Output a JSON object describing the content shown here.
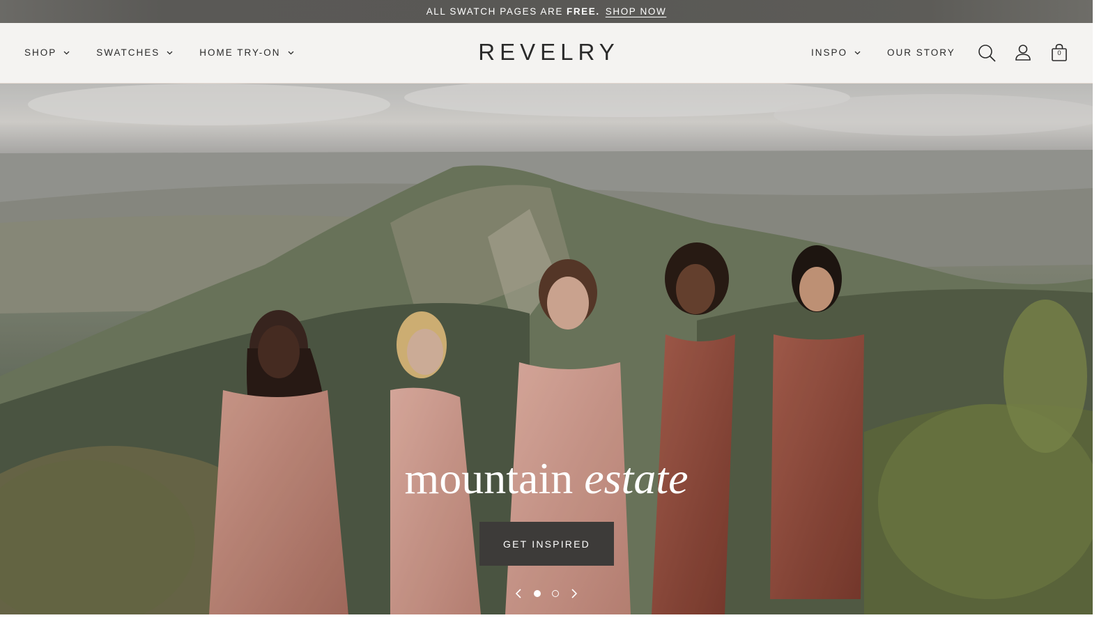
{
  "announcement": {
    "prefix": "ALL SWATCH PAGES ARE",
    "emphasis": "FREE.",
    "link_label": "SHOP NOW"
  },
  "header": {
    "logo": "REVELRY",
    "nav_left": [
      {
        "label": "SHOP",
        "has_dropdown": true,
        "icon": "chevron-down-icon"
      },
      {
        "label": "SWATCHES",
        "has_dropdown": true,
        "icon": "chevron-down-icon"
      },
      {
        "label": "HOME TRY-ON",
        "has_dropdown": true,
        "icon": "chevron-down-icon"
      }
    ],
    "nav_right": [
      {
        "label": "INSPO",
        "has_dropdown": true,
        "icon": "chevron-down-icon"
      },
      {
        "label": "OUR STORY",
        "has_dropdown": false
      }
    ],
    "icons": [
      "search-icon",
      "account-icon",
      "shopping-bag-icon"
    ],
    "cart_count": "0"
  },
  "hero": {
    "title_regular": "mountain",
    "title_italic": "estate",
    "cta_label": "GET INSPIRED",
    "slides_total": 2,
    "active_slide": 1
  },
  "colors": {
    "announcement_bg": "#5a5956",
    "header_bg": "#f4f3f1",
    "cta_bg": "#3d3b39",
    "text_dark": "#2b2b2b",
    "dress_rose": "#c48a7c",
    "dress_rust": "#8e4b3c"
  }
}
